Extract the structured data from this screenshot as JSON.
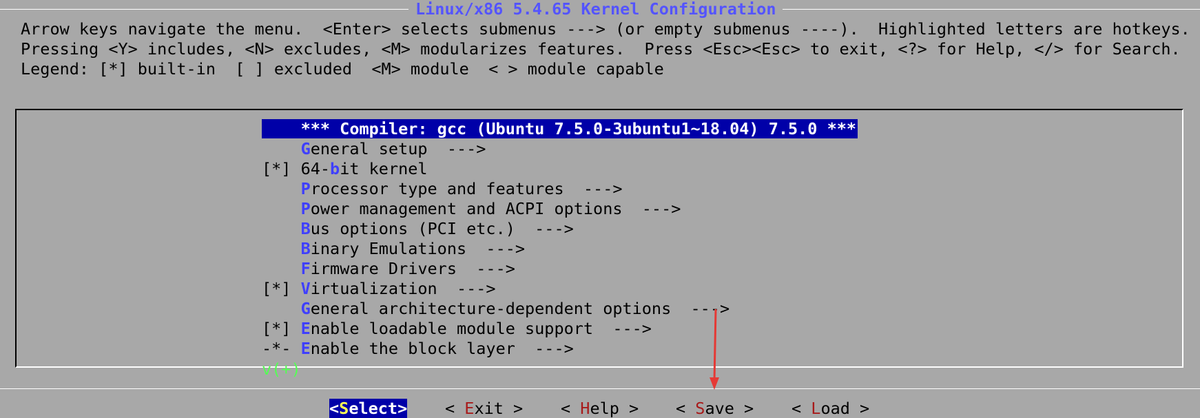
{
  "title": "Linux/x86 5.4.65 Kernel Configuration",
  "help_lines": [
    "Arrow keys navigate the menu.  <Enter> selects submenus ---> (or empty submenus ----).  Highlighted letters are hotkeys.",
    "Pressing <Y> includes, <N> excludes, <M> modularizes features.  Press <Esc><Esc> to exit, <?> for Help, </> for Search.",
    "Legend: [*] built-in  [ ] excluded  <M> module  < > module capable"
  ],
  "menu": {
    "items": [
      {
        "prefix": "    ",
        "hotkey": "",
        "rest": "*** Compiler: gcc (Ubuntu 7.5.0-3ubuntu1~18.04) 7.5.0 ***",
        "selected": true
      },
      {
        "prefix": "    ",
        "hotkey": "G",
        "rest": "eneral setup  --->",
        "selected": false
      },
      {
        "prefix": "[*] ",
        "hotkey": "",
        "rest": "64-",
        "hotkey2": "b",
        "rest2": "it kernel",
        "selected": false
      },
      {
        "prefix": "    ",
        "hotkey": "P",
        "rest": "rocessor type and features  --->",
        "selected": false
      },
      {
        "prefix": "    ",
        "hotkey": "P",
        "rest": "ower management and ACPI options  --->",
        "selected": false
      },
      {
        "prefix": "    ",
        "hotkey": "B",
        "rest": "us options (PCI etc.)  --->",
        "selected": false
      },
      {
        "prefix": "    ",
        "hotkey": "B",
        "rest": "inary Emulations  --->",
        "selected": false
      },
      {
        "prefix": "    ",
        "hotkey": "F",
        "rest": "irmware Drivers  --->",
        "selected": false
      },
      {
        "prefix": "[*] ",
        "hotkey": "V",
        "rest": "irtualization  --->",
        "selected": false
      },
      {
        "prefix": "    ",
        "hotkey": "G",
        "rest": "eneral architecture-dependent options  --->",
        "selected": false
      },
      {
        "prefix": "[*] ",
        "hotkey": "E",
        "rest": "nable loadable module support  --->",
        "selected": false
      },
      {
        "prefix": "-*- ",
        "hotkey": "E",
        "rest": "nable the block layer  --->",
        "selected": false
      }
    ],
    "more_indicator": "v(+)"
  },
  "buttons": [
    {
      "open": "<",
      "hotkey": "S",
      "rest": "elect",
      "close": ">",
      "selected": true
    },
    {
      "open": "< ",
      "hotkey": "E",
      "rest": "xit",
      "close": " >",
      "selected": false
    },
    {
      "open": "< ",
      "hotkey": "H",
      "rest": "elp",
      "close": " >",
      "selected": false
    },
    {
      "open": "< ",
      "hotkey": "S",
      "rest": "ave",
      "close": " >",
      "selected": false
    },
    {
      "open": "< ",
      "hotkey": "L",
      "rest": "oad",
      "close": " >",
      "selected": false
    }
  ],
  "colors": {
    "background": "#a8a8a8",
    "highlight_bg": "#0000a8",
    "hotkey": "#5454ff",
    "button_hotkey": "#a81a1a",
    "more_indicator": "#54ff54",
    "annotation_arrow": "#e53935"
  }
}
